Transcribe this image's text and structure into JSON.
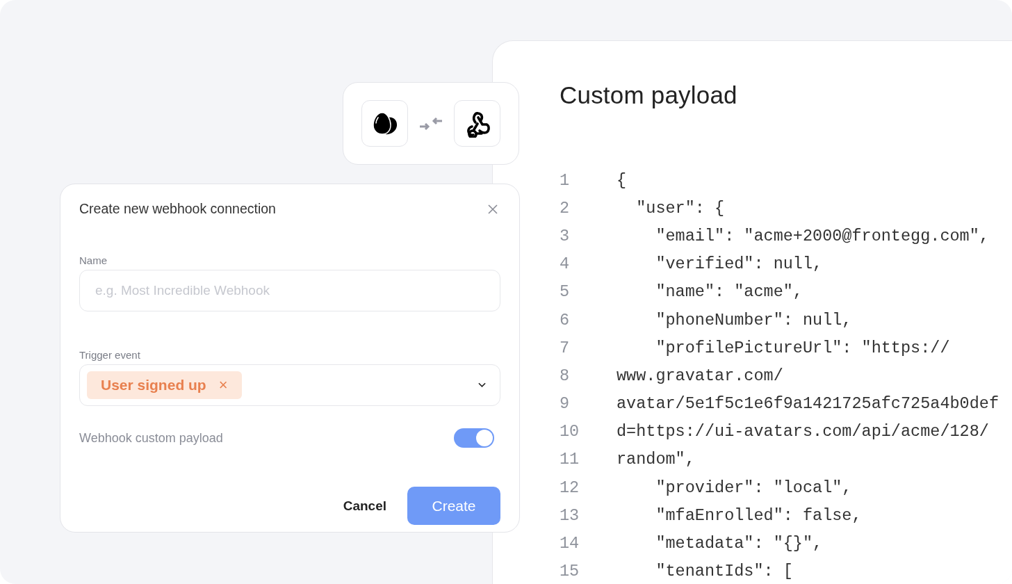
{
  "payload_panel": {
    "title": "Custom payload",
    "code_lines": [
      {
        "number": "1",
        "text": "{"
      },
      {
        "number": "2",
        "text": "  \"user\": {"
      },
      {
        "number": "3",
        "text": "    \"email\": \"acme+2000@frontegg.com\","
      },
      {
        "number": "4",
        "text": "    \"verified\": null,"
      },
      {
        "number": "5",
        "text": "    \"name\": \"acme\","
      },
      {
        "number": "6",
        "text": "    \"phoneNumber\": null,"
      },
      {
        "number": "7",
        "text": "    \"profilePictureUrl\": \"https://"
      },
      {
        "number": "8",
        "text": "www.gravatar.com/"
      },
      {
        "number": "9",
        "text": "avatar/5e1f5c1e6f9a1421725afc725a4b0def"
      },
      {
        "number": "10",
        "text": "d=https://ui-avatars.com/api/acme/128/"
      },
      {
        "number": "11",
        "text": "random\","
      },
      {
        "number": "12",
        "text": "    \"provider\": \"local\","
      },
      {
        "number": "13",
        "text": "    \"mfaEnrolled\": false,"
      },
      {
        "number": "14",
        "text": "    \"metadata\": \"{}\","
      },
      {
        "number": "15",
        "text": "    \"tenantIds\": ["
      }
    ]
  },
  "dialog": {
    "title": "Create new webhook connection",
    "name_field": {
      "label": "Name",
      "placeholder": "e.g. Most Incredible Webhook"
    },
    "trigger_field": {
      "label": "Trigger event",
      "chips": [
        {
          "label": "User signed up",
          "remove": "×"
        }
      ]
    },
    "custom_payload_toggle": {
      "label": "Webhook custom payload",
      "on": true
    },
    "buttons": [
      {
        "label": "Cancel",
        "kind": "text"
      },
      {
        "label": "Create",
        "kind": "primary"
      }
    ]
  }
}
